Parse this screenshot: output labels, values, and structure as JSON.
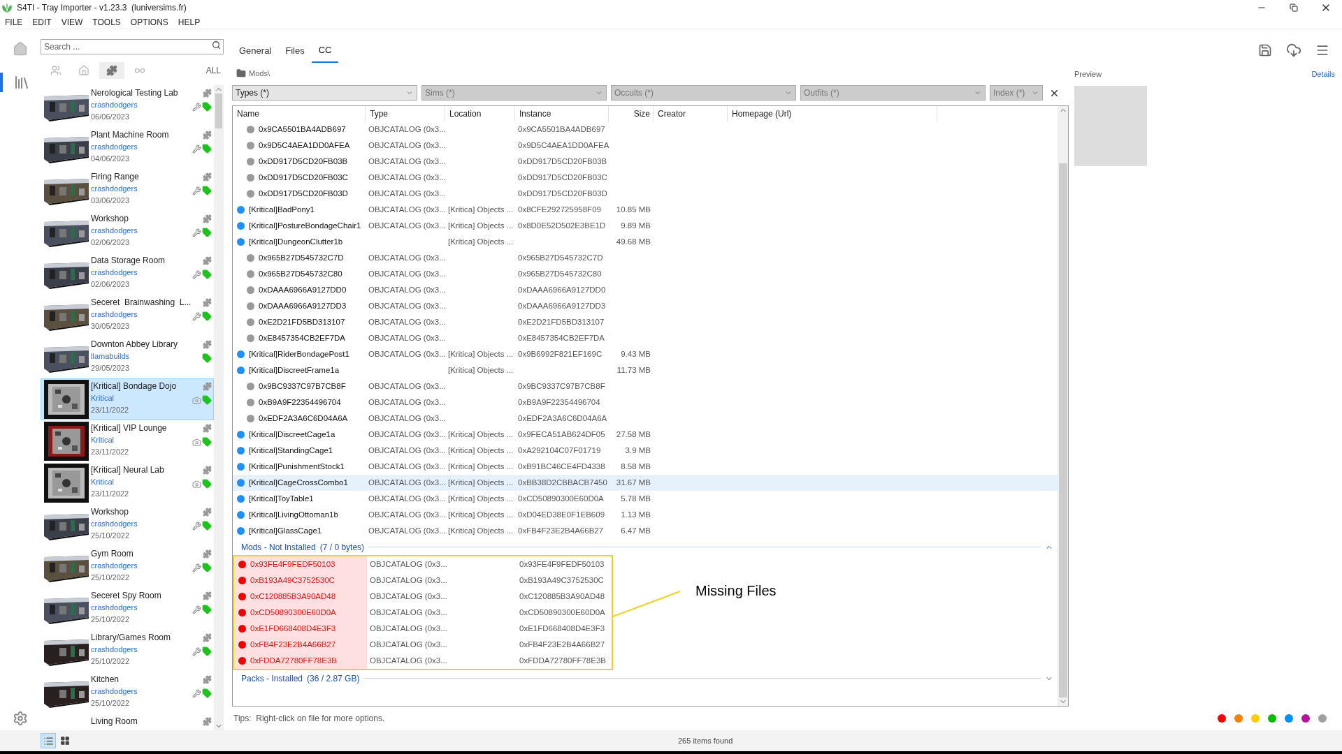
{
  "window": {
    "title": "S4TI - Tray Importer - v1.23.3  (luniversims.fr)"
  },
  "menu": [
    "FILE",
    "EDIT",
    "VIEW",
    "TOOLS",
    "OPTIONS",
    "HELP"
  ],
  "rail": [
    {
      "kind": "home",
      "selected": false
    },
    {
      "kind": "library",
      "selected": true
    }
  ],
  "sidebar": {
    "search": {
      "placeholder": "Search ..."
    },
    "filters": [
      {
        "kind": "sims",
        "selected": false
      },
      {
        "kind": "lot",
        "selected": false
      },
      {
        "kind": "room",
        "selected": true
      },
      {
        "kind": "infinity",
        "selected": false
      },
      {
        "kind": "all",
        "label": "ALL",
        "selected": false
      }
    ],
    "items": [
      {
        "title": "Nerological Testing Lab",
        "author": "crashdodgers",
        "date": "06/06/2023",
        "kind": "wrench",
        "selected": false
      },
      {
        "title": "Plant Machine Room",
        "author": "crashdodgers",
        "date": "04/06/2023",
        "kind": "wrench",
        "selected": false
      },
      {
        "title": "Firing Range",
        "author": "crashdodgers",
        "date": "03/06/2023",
        "kind": "wrench",
        "selected": false
      },
      {
        "title": "Workshop",
        "author": "crashdodgers",
        "date": "02/06/2023",
        "kind": "wrench",
        "selected": false
      },
      {
        "title": "Data Storage Room",
        "author": "crashdodgers",
        "date": "02/06/2023",
        "kind": "wrench",
        "selected": false
      },
      {
        "title": "Seceret  Brainwashing  L...",
        "author": "crashdodgers",
        "date": "30/05/2023",
        "kind": "wrench",
        "selected": false
      },
      {
        "title": "Downton Abbey Library",
        "author": "llamabuilds",
        "date": "29/05/2023",
        "kind": "plain",
        "selected": false
      },
      {
        "title": "[Kritical] Bondage Dojo",
        "author": "Kritical",
        "date": "23/11/2022",
        "kind": "camera",
        "selected": true
      },
      {
        "title": "[Kritical] VIP Lounge",
        "author": "Kritical",
        "date": "23/11/2022",
        "kind": "camera",
        "selected": false
      },
      {
        "title": "[Kritical] Neural Lab",
        "author": "Kritical",
        "date": "23/11/2022",
        "kind": "camera",
        "selected": false
      },
      {
        "title": "Workshop",
        "author": "crashdodgers",
        "date": "25/10/2022",
        "kind": "wrench",
        "selected": false
      },
      {
        "title": "Gym Room",
        "author": "crashdodgers",
        "date": "25/10/2022",
        "kind": "wrench",
        "selected": false
      },
      {
        "title": "Seceret Spy Room",
        "author": "crashdodgers",
        "date": "25/10/2022",
        "kind": "wrench",
        "selected": false
      },
      {
        "title": "Library/Games Room",
        "author": "crashdodgers",
        "date": "25/10/2022",
        "kind": "wrench",
        "selected": false
      },
      {
        "title": "Kitchen",
        "author": "crashdodgers",
        "date": "25/10/2022",
        "kind": "wrench",
        "selected": false
      },
      {
        "title": "Living Room",
        "kind": "partial",
        "selected": false
      }
    ]
  },
  "tabs": [
    {
      "label": "General",
      "selected": false
    },
    {
      "label": "Files",
      "selected": false
    },
    {
      "label": "CC",
      "selected": true
    }
  ],
  "path": "Mods\\",
  "filters": [
    {
      "label": "Types (*)",
      "disabled": false
    },
    {
      "label": "Sims (*)",
      "disabled": true
    },
    {
      "label": "Occults (*)",
      "disabled": true
    },
    {
      "label": "Outfits (*)",
      "disabled": true
    },
    {
      "label": "Index (*)",
      "disabled": true
    }
  ],
  "table": {
    "columns": [
      "Name",
      "Type",
      "Location",
      "Instance",
      "Size",
      "Creator",
      "Homepage (Url)"
    ],
    "rows": [
      {
        "kind": "file",
        "name": "0x9CA5501BA4ADB697",
        "type": "OBJCATALOG (0x3...",
        "instance": "0x9CA5501BA4ADB697",
        "selected": false
      },
      {
        "kind": "file",
        "name": "0x9D5C4AEA1DD0AFEA",
        "type": "OBJCATALOG (0x3...",
        "instance": "0x9D5C4AEA1DD0AFEA",
        "selected": false
      },
      {
        "kind": "file",
        "name": "0xDD917D5CD20FB03B",
        "type": "OBJCATALOG (0x3...",
        "instance": "0xDD917D5CD20FB03B",
        "selected": false
      },
      {
        "kind": "file",
        "name": "0xDD917D5CD20FB03C",
        "type": "OBJCATALOG (0x3...",
        "instance": "0xDD917D5CD20FB03C",
        "selected": false
      },
      {
        "kind": "file",
        "name": "0xDD917D5CD20FB03D",
        "type": "OBJCATALOG (0x3...",
        "instance": "0xDD917D5CD20FB03D",
        "selected": false
      },
      {
        "kind": "group",
        "name": "[Kritical]BadPony1",
        "type": "OBJCATALOG (0x3...",
        "location": "[Kritica] Objects ...",
        "instance": "0x8CFE292725958F09",
        "size": "10.85 MB",
        "selected": false
      },
      {
        "kind": "group",
        "name": "[Kritical]PostureBondageChair1",
        "type": "OBJCATALOG (0x3...",
        "location": "[Kritica] Objects ...",
        "instance": "0x8D0E52D502E3BE1D",
        "size": "9.89 MB",
        "selected": false
      },
      {
        "kind": "group",
        "name": "[Kritical]DungeonClutter1b",
        "location": "[Kritica] Objects ...",
        "size": "49.68 MB",
        "selected": false
      },
      {
        "kind": "file",
        "name": "0x965B27D545732C7D",
        "type": "OBJCATALOG (0x3...",
        "instance": "0x965B27D545732C7D",
        "selected": false
      },
      {
        "kind": "file",
        "name": "0x965B27D545732C80",
        "type": "OBJCATALOG (0x3...",
        "instance": "0x965B27D545732C80",
        "selected": false
      },
      {
        "kind": "file",
        "name": "0xDAAA6966A9127DD0",
        "type": "OBJCATALOG (0x3...",
        "instance": "0xDAAA6966A9127DD0",
        "selected": false
      },
      {
        "kind": "file",
        "name": "0xDAAA6966A9127DD3",
        "type": "OBJCATALOG (0x3...",
        "instance": "0xDAAA6966A9127DD3",
        "selected": false
      },
      {
        "kind": "file",
        "name": "0xE2D21FD5BD313107",
        "type": "OBJCATALOG (0x3...",
        "instance": "0xE2D21FD5BD313107",
        "selected": false
      },
      {
        "kind": "file",
        "name": "0xE8457354CB2EF7DA",
        "type": "OBJCATALOG (0x3...",
        "instance": "0xE8457354CB2EF7DA",
        "selected": false
      },
      {
        "kind": "group",
        "name": "[Kritical]RiderBondagePost1",
        "type": "OBJCATALOG (0x3...",
        "location": "[Kritica] Objects ...",
        "instance": "0x9B6992F821EF169C",
        "size": "9.43 MB",
        "selected": false
      },
      {
        "kind": "group",
        "name": "[Kritical]DiscreetFrame1a",
        "location": "[Kritica] Objects ...",
        "size": "11.73 MB",
        "selected": false
      },
      {
        "kind": "file",
        "name": "0x9BC9337C97B7CB8F",
        "type": "OBJCATALOG (0x3...",
        "instance": "0x9BC9337C97B7CB8F",
        "selected": false
      },
      {
        "kind": "file",
        "name": "0xB9A9F22354496704",
        "type": "OBJCATALOG (0x3...",
        "instance": "0xB9A9F22354496704",
        "selected": false
      },
      {
        "kind": "file",
        "name": "0xEDF2A3A6C6D04A6A",
        "type": "OBJCATALOG (0x3...",
        "instance": "0xEDF2A3A6C6D04A6A",
        "selected": false
      },
      {
        "kind": "group",
        "name": "[Kritical]DiscreetCage1a",
        "type": "OBJCATALOG (0x3...",
        "location": "[Kritica] Objects ...",
        "instance": "0x9FECA51AB624DF05",
        "size": "27.58 MB",
        "selected": false
      },
      {
        "kind": "group",
        "name": "[Kritical]StandingCage1",
        "type": "OBJCATALOG (0x3...",
        "location": "[Kritica] Objects ...",
        "instance": "0xA292104C07F01719",
        "size": "3.9 MB",
        "selected": false
      },
      {
        "kind": "group",
        "name": "[Kritical]PunishmentStock1",
        "type": "OBJCATALOG (0x3...",
        "location": "[Kritica] Objects ...",
        "instance": "0xB91BC46CE4FD4338",
        "size": "8.58 MB",
        "selected": false
      },
      {
        "kind": "group",
        "name": "[Kritical]CageCrossCombo1",
        "type": "OBJCATALOG (0x3...",
        "location": "[Kritica] Objects ...",
        "instance": "0xBB38D2CBBACB7450",
        "size": "31.67 MB",
        "selected": true
      },
      {
        "kind": "group",
        "name": "[Kritical]ToyTable1",
        "type": "OBJCATALOG (0x3...",
        "location": "[Kritica] Objects ...",
        "instance": "0xCD50890300E60D0A",
        "size": "5.78 MB",
        "selected": false
      },
      {
        "kind": "group",
        "name": "[Kritical]LivingOttoman1b",
        "type": "OBJCATALOG (0x3...",
        "location": "[Kritica] Objects ...",
        "instance": "0xD04ED38E0F1EB609",
        "size": "1.13 MB",
        "selected": false
      },
      {
        "kind": "group",
        "name": "[Kritical]GlassCage1",
        "type": "OBJCATALOG (0x3...",
        "location": "[Kritica] Objects ...",
        "instance": "0xFB4F23E2B4A66B27",
        "size": "6.47 MB",
        "selected": false
      }
    ],
    "sections": [
      {
        "title": "Mods - Not Installed",
        "count": "(7 / 0 bytes)",
        "expanded": true,
        "annotation": "Missing Files",
        "rows": [
          {
            "kind": "missing",
            "name": "0x93FE4F9FEDF50103",
            "type": "OBJCATALOG (0x3...",
            "instance": "0x93FE4F9FEDF50103",
            "selected": false
          },
          {
            "kind": "missing",
            "name": "0xB193A49C3752530C",
            "type": "OBJCATALOG (0x3...",
            "instance": "0xB193A49C3752530C",
            "selected": false
          },
          {
            "kind": "missing",
            "name": "0xC120885B3A90AD48",
            "type": "OBJCATALOG (0x3...",
            "instance": "0xC120885B3A90AD48",
            "selected": false
          },
          {
            "kind": "missing",
            "name": "0xCD50890300E60D0A",
            "type": "OBJCATALOG (0x3...",
            "instance": "0xCD50890300E60D0A",
            "selected": false
          },
          {
            "kind": "missing",
            "name": "0xE1FD668408D4E3F3",
            "type": "OBJCATALOG (0x3...",
            "instance": "0xE1FD668408D4E3F3",
            "selected": false
          },
          {
            "kind": "missing",
            "name": "0xFB4F23E2B4A66B27",
            "type": "OBJCATALOG (0x3...",
            "instance": "0xFB4F23E2B4A66B27",
            "selected": false
          },
          {
            "kind": "missing",
            "name": "0xFDDA72780FF78E3B",
            "type": "OBJCATALOG (0x3...",
            "instance": "0xFDDA72780FF78E3B",
            "selected": false
          }
        ]
      },
      {
        "title": "Packs - Installed",
        "count": "(36 / 2.87 GB)",
        "expanded": false
      }
    ]
  },
  "tips": "Tips:  Right-click on file for more options.",
  "preview": {
    "title": "Preview",
    "link": "Details"
  },
  "swatches": [
    {
      "color": "#ff0000"
    },
    {
      "color": "#ff8000"
    },
    {
      "color": "#ffcc00"
    },
    {
      "color": "#00c000"
    },
    {
      "color": "#0090ff"
    },
    {
      "color": "#c010a0"
    },
    {
      "color": "#a0a0a0"
    }
  ],
  "views": [
    {
      "kind": "list",
      "selected": true
    },
    {
      "kind": "grid",
      "selected": false
    }
  ],
  "status": "265 items found"
}
